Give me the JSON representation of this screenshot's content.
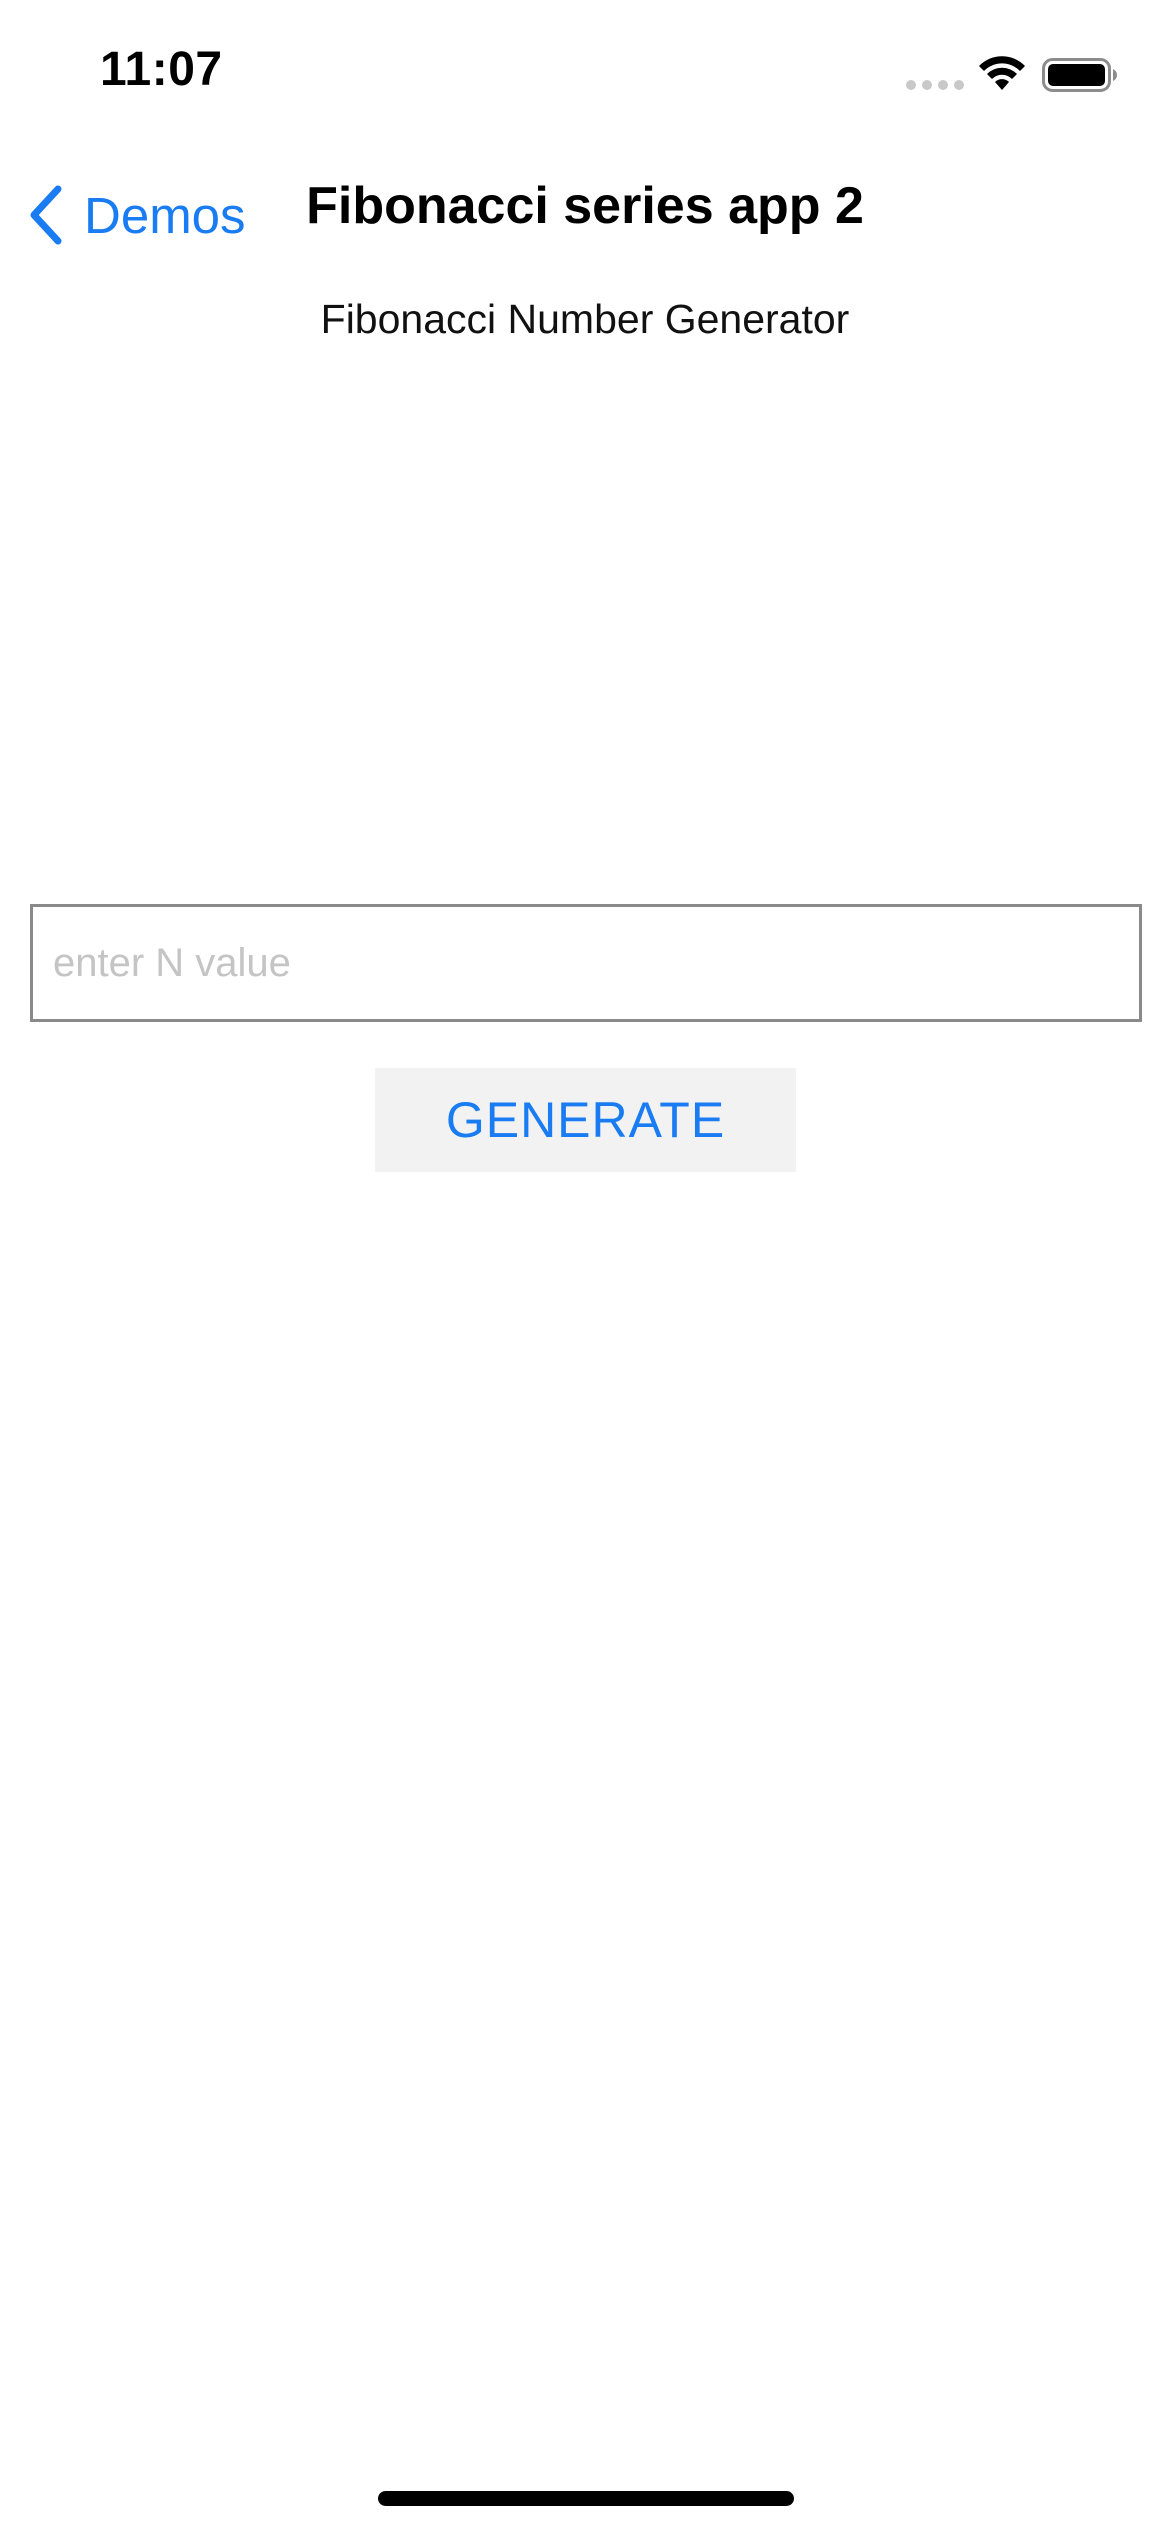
{
  "status_bar": {
    "time": "11:07",
    "icons": [
      "signal-icon",
      "wifi-icon",
      "battery-icon"
    ]
  },
  "nav": {
    "back_label": "Demos",
    "title": "Fibonacci series app 2",
    "accent_color": "#1a7cf2"
  },
  "main": {
    "subtitle": "Fibonacci Number Generator",
    "input": {
      "value": "",
      "placeholder": "enter N value"
    },
    "generate_label": "GENERATE"
  }
}
